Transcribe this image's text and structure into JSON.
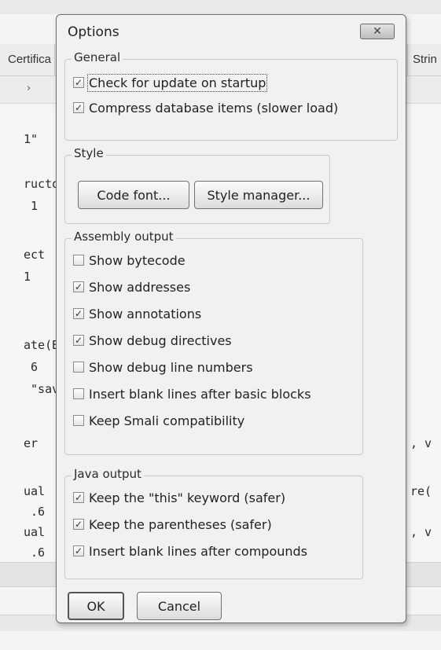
{
  "background": {
    "tab_left": "Certifica",
    "tab_right": "Strin",
    "code_left": [
      "1\"",
      "ructo",
      " 1",
      "ect",
      "1",
      "ate(B",
      " 6",
      " \"sav",
      "er",
      "ual",
      " .6",
      "ual",
      " .6"
    ],
    "code_right": [
      ", v",
      "re(",
      ", v"
    ]
  },
  "dialog": {
    "title": "Options",
    "close_glyph": "✕",
    "general": {
      "label": "General",
      "items": [
        {
          "label": "Check for update on startup",
          "checked": true
        },
        {
          "label": "Compress database items (slower load)",
          "checked": true
        }
      ]
    },
    "style": {
      "label": "Style",
      "code_font_button": "Code font...",
      "style_manager_button": "Style manager..."
    },
    "assembly": {
      "label": "Assembly output",
      "items": [
        {
          "label": "Show bytecode",
          "checked": false
        },
        {
          "label": "Show addresses",
          "checked": true
        },
        {
          "label": "Show annotations",
          "checked": true
        },
        {
          "label": "Show debug directives",
          "checked": true
        },
        {
          "label": "Show debug line numbers",
          "checked": false
        },
        {
          "label": "Insert blank lines after basic blocks",
          "checked": false
        },
        {
          "label": "Keep Smali compatibility",
          "checked": false
        }
      ]
    },
    "java": {
      "label": "Java output",
      "items": [
        {
          "label": "Keep the \"this\" keyword (safer)",
          "checked": true
        },
        {
          "label": "Keep the parentheses (safer)",
          "checked": true
        },
        {
          "label": "Insert blank lines after compounds",
          "checked": true
        }
      ]
    },
    "ok_button": "OK",
    "cancel_button": "Cancel"
  }
}
